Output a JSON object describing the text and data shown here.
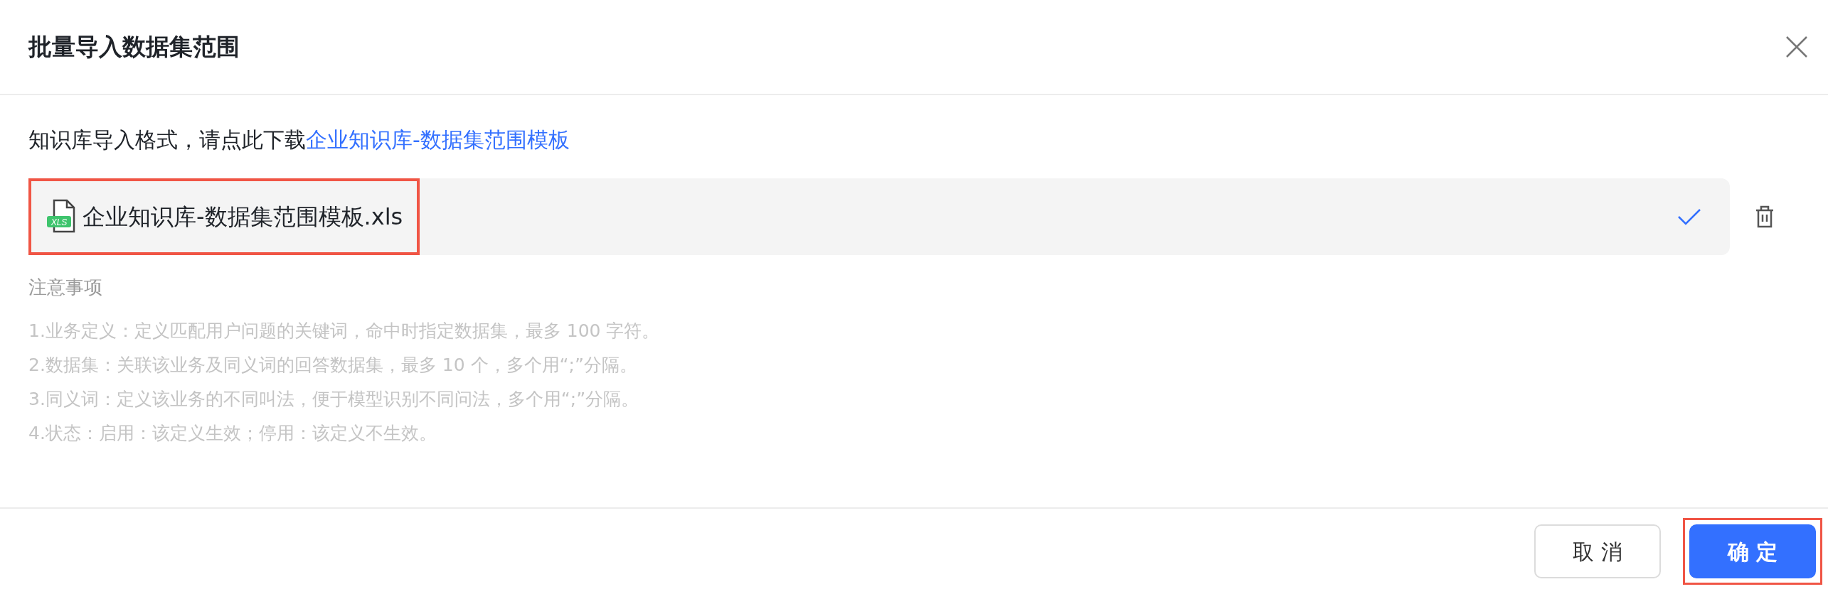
{
  "dialog": {
    "title": "批量导入数据集范围"
  },
  "instruction": {
    "text": "知识库导入格式，请点此下载",
    "link": "企业知识库-数据集范围模板"
  },
  "file": {
    "icon_label": "XLS",
    "name": "企业知识库-数据集范围模板.xls",
    "uploaded": true,
    "highlighted": true
  },
  "notes": {
    "heading": "注意事项",
    "items": [
      "1.业务定义：定义匹配用户问题的关键词，命中时指定数据集，最多 100 字符。",
      "2.数据集：关联该业务及同义词的回答数据集，最多 10 个，多个用“;”分隔。",
      "3.同义词：定义该业务的不同叫法，便于模型识别不同问法，多个用“;”分隔。",
      "4.状态：启用：该定义生效；停用：该定义不生效。"
    ]
  },
  "buttons": [
    {
      "label": "取 消",
      "kind": "secondary",
      "highlighted": false
    },
    {
      "label": "确 定",
      "kind": "primary",
      "highlighted": true
    }
  ]
}
